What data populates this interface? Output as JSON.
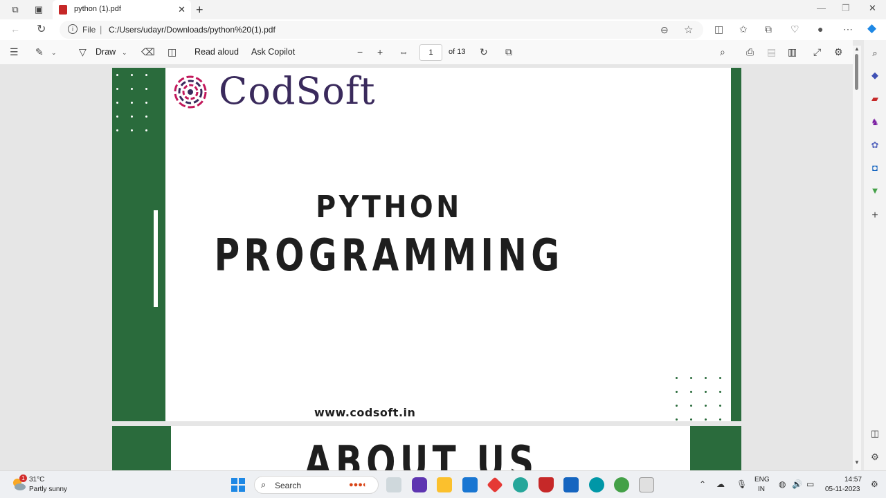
{
  "browser": {
    "tab_title": "python (1).pdf",
    "address_prefix": "File",
    "address_url": "C:/Users/udayr/Downloads/python%20(1).pdf"
  },
  "pdf_toolbar": {
    "draw_label": "Draw",
    "read_aloud_label": "Read aloud",
    "ask_copilot_label": "Ask Copilot",
    "page_number": "1",
    "page_total": "of 13"
  },
  "page1": {
    "logo_text": "CodSoft",
    "title_line1": "PYTHON",
    "title_line2": "PROGRAMMING",
    "website": "www.codsoft.in"
  },
  "page2": {
    "title": "ABOUT US"
  },
  "taskbar": {
    "weather_badge": "1",
    "weather_temp": "31°C",
    "weather_desc": "Partly sunny",
    "search_label": "Search",
    "language_top": "ENG",
    "language_bottom": "IN",
    "time": "14:57",
    "date": "05-11-2023"
  },
  "colors": {
    "green_accent": "#2a6b3c",
    "logo_purple": "#3a2a5c",
    "logo_red": "#c2185b"
  }
}
